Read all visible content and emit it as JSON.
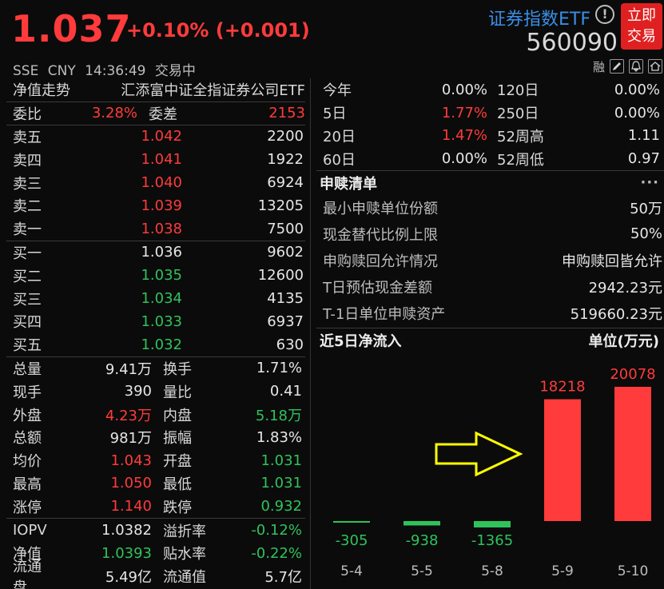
{
  "header": {
    "price": "1.037",
    "change": "+0.10% (+0.001)",
    "exchange": "SSE",
    "currency": "CNY",
    "time": "14:36:49",
    "status": "交易中",
    "title": "证券指数ETF",
    "code": "560090",
    "trade_btn_line1": "立即",
    "trade_btn_line2": "交易",
    "toolbar_label": "融"
  },
  "left": {
    "fund_label": "净值走势",
    "fund_name": "汇添富中证全指证券公司ETF",
    "weibi": {
      "label": "委比",
      "value": "3.28%",
      "label2": "委差",
      "value2": "2153"
    },
    "asks": [
      {
        "label": "卖五",
        "price": "1.042",
        "vol": "2200"
      },
      {
        "label": "卖四",
        "price": "1.041",
        "vol": "1922"
      },
      {
        "label": "卖三",
        "price": "1.040",
        "vol": "6924"
      },
      {
        "label": "卖二",
        "price": "1.039",
        "vol": "13205"
      },
      {
        "label": "卖一",
        "price": "1.038",
        "vol": "7500"
      }
    ],
    "bids": [
      {
        "label": "买一",
        "price": "1.036",
        "vol": "9602"
      },
      {
        "label": "买二",
        "price": "1.035",
        "vol": "12600"
      },
      {
        "label": "买三",
        "price": "1.034",
        "vol": "4135"
      },
      {
        "label": "买四",
        "price": "1.033",
        "vol": "6937"
      },
      {
        "label": "买五",
        "price": "1.032",
        "vol": "630"
      }
    ],
    "stats": [
      {
        "l1": "总量",
        "v1": "9.41万",
        "l2": "换手",
        "v2": "1.71%"
      },
      {
        "l1": "现手",
        "v1": "390",
        "l2": "量比",
        "v2": "0.41"
      },
      {
        "l1": "外盘",
        "v1": "4.23万",
        "l2": "内盘",
        "v2": "5.18万"
      },
      {
        "l1": "总额",
        "v1": "981万",
        "l2": "振幅",
        "v2": "1.83%"
      },
      {
        "l1": "均价",
        "v1": "1.043",
        "l2": "开盘",
        "v2": "1.031"
      },
      {
        "l1": "最高",
        "v1": "1.050",
        "l2": "最低",
        "v2": "1.031"
      },
      {
        "l1": "涨停",
        "v1": "1.140",
        "l2": "跌停",
        "v2": "0.932"
      }
    ],
    "nav": [
      {
        "l1": "IOPV",
        "v1": "1.0382",
        "l2": "溢折率",
        "v2": "-0.12%"
      },
      {
        "l1": "净值",
        "v1": "1.0393",
        "l2": "贴水率",
        "v2": "-0.22%"
      },
      {
        "l1": "流通盘",
        "v1": "5.49亿",
        "l2": "流通值",
        "v2": "5.7亿"
      }
    ]
  },
  "right": {
    "perf": [
      {
        "l1": "今年",
        "v1": "0.00%",
        "l2": "120日",
        "v2": "0.00%"
      },
      {
        "l1": "5日",
        "v1": "1.77%",
        "l2": "250日",
        "v2": "0.00%"
      },
      {
        "l1": "20日",
        "v1": "1.47%",
        "l2": "52周高",
        "v2": "1.11"
      },
      {
        "l1": "60日",
        "v1": "0.00%",
        "l2": "52周低",
        "v2": "0.97"
      }
    ],
    "redemption": {
      "title": "申赎清单",
      "more": "···",
      "rows": [
        {
          "label": "最小申赎单位份额",
          "value": "50万"
        },
        {
          "label": "现金替代比例上限",
          "value": "50%"
        },
        {
          "label": "申购赎回允许情况",
          "value": "申购赎回皆允许"
        },
        {
          "label": "T日预估现金差额",
          "value": "2942.23元"
        },
        {
          "label": "T-1日单位申赎资产",
          "value": "519660.23元"
        }
      ]
    },
    "flow": {
      "title": "近5日净流入",
      "unit": "单位(万元)"
    }
  },
  "colors": {
    "up": "#ff3b3b",
    "down": "#2fc25b",
    "link": "#3a8ee6",
    "arrow": "#ffff00"
  },
  "chart_data": {
    "type": "bar",
    "categories": [
      "5-4",
      "5-5",
      "5-8",
      "5-9",
      "5-10"
    ],
    "values": [
      -305,
      -938,
      -1365,
      18218,
      20078
    ],
    "ylabel": "单位(万元)"
  }
}
